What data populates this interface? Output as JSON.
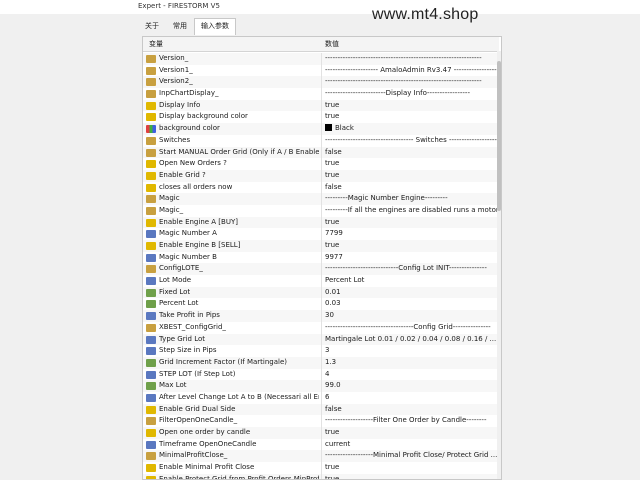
{
  "window": {
    "title": "Expert - FIRESTORM V5"
  },
  "watermark": "www.mt4.shop",
  "tabs": [
    {
      "label": "关于"
    },
    {
      "label": "常用"
    },
    {
      "label": "输入参数"
    }
  ],
  "table": {
    "headers": {
      "variable": "变量",
      "value": "数值"
    },
    "rows": [
      {
        "type": "str",
        "name": "Version_",
        "value": "--------------------------------------------------------------"
      },
      {
        "type": "str",
        "name": "Version1_",
        "value": "--------------------- AmaloAdmin   Rv3.47 -----------------"
      },
      {
        "type": "str",
        "name": "Version2_",
        "value": "--------------------------------------------------------------"
      },
      {
        "type": "str",
        "name": "InpChartDisplay_",
        "value": "------------------------Display Info-----------------"
      },
      {
        "type": "bool",
        "name": "Display Info",
        "value": "true"
      },
      {
        "type": "bool",
        "name": "Display background color",
        "value": "true"
      },
      {
        "type": "clr",
        "name": "background color",
        "value": "Black",
        "swatch": "#000000"
      },
      {
        "type": "str",
        "name": "Switches",
        "value": "----------------------------------- Switches ---------------------"
      },
      {
        "type": "str",
        "name": "Start MANUAL Order  Grid  (Only if A / B Enable)",
        "value": "false"
      },
      {
        "type": "bool",
        "name": "Open New Orders ?",
        "value": "true"
      },
      {
        "type": "bool",
        "name": "Enable Grid ?",
        "value": "true"
      },
      {
        "type": "bool",
        "name": "closes all orders now",
        "value": "false"
      },
      {
        "type": "str",
        "name": "Magic",
        "value": "---------Magic Number Engine---------"
      },
      {
        "type": "str",
        "name": "Magic_",
        "value": "---------If all the engines are disabled runs a motor i..."
      },
      {
        "type": "bool",
        "name": "Enable Engine A   [BUY]",
        "value": "true"
      },
      {
        "type": "int",
        "name": "Magic Number  A",
        "value": "7799"
      },
      {
        "type": "bool",
        "name": "Enable Engine B   [SELL]",
        "value": "true"
      },
      {
        "type": "int",
        "name": "Magic Number  B",
        "value": "9977"
      },
      {
        "type": "str",
        "name": "ConfigLOTE_",
        "value": "-----------------------------Config Lot INIT---------------"
      },
      {
        "type": "int",
        "name": "Lot Mode",
        "value": "Percent Lot"
      },
      {
        "type": "dbl",
        "name": "Fixed Lot",
        "value": "0.01"
      },
      {
        "type": "dbl",
        "name": "Percent Lot",
        "value": "0.03"
      },
      {
        "type": "int",
        "name": "Take Profit in Pips",
        "value": "30"
      },
      {
        "type": "str",
        "name": "XBEST_ConfigGrid_",
        "value": "-----------------------------------Config Grid---------------"
      },
      {
        "type": "int",
        "name": "Type Grid Lot",
        "value": "Martingale Lot  0.01 / 0.02 / 0.04 / 0.08 / 0.16 / ........."
      },
      {
        "type": "int",
        "name": "Step Size in Pips",
        "value": "3"
      },
      {
        "type": "dbl",
        "name": "Grid Increment Factor (If Martingale)",
        "value": "1.3"
      },
      {
        "type": "int",
        "name": "STEP LOT (If  Step Lot)",
        "value": "4"
      },
      {
        "type": "dbl",
        "name": "Max Lot",
        "value": "99.0"
      },
      {
        "type": "int",
        "name": "After Level Change Lot A to B (Necessari all Engi...",
        "value": "6"
      },
      {
        "type": "bool",
        "name": "Enable Grid Dual Side",
        "value": "false"
      },
      {
        "type": "str",
        "name": "FilterOpenOneCandle_",
        "value": "-------------------Filter One Order by Candle--------"
      },
      {
        "type": "bool",
        "name": "Open one order by candle",
        "value": "true"
      },
      {
        "type": "int",
        "name": "Timeframe OpenOneCandle",
        "value": "current"
      },
      {
        "type": "str",
        "name": "MinimalProfitClose_",
        "value": "-------------------Minimal Profit Close/ Protect Grid ..."
      },
      {
        "type": "bool",
        "name": "Enable  Minimal Profit Close",
        "value": "true"
      },
      {
        "type": "bool",
        "name": "Enable Protect Grid from Profit Orders MinProfit",
        "value": "true"
      }
    ]
  }
}
